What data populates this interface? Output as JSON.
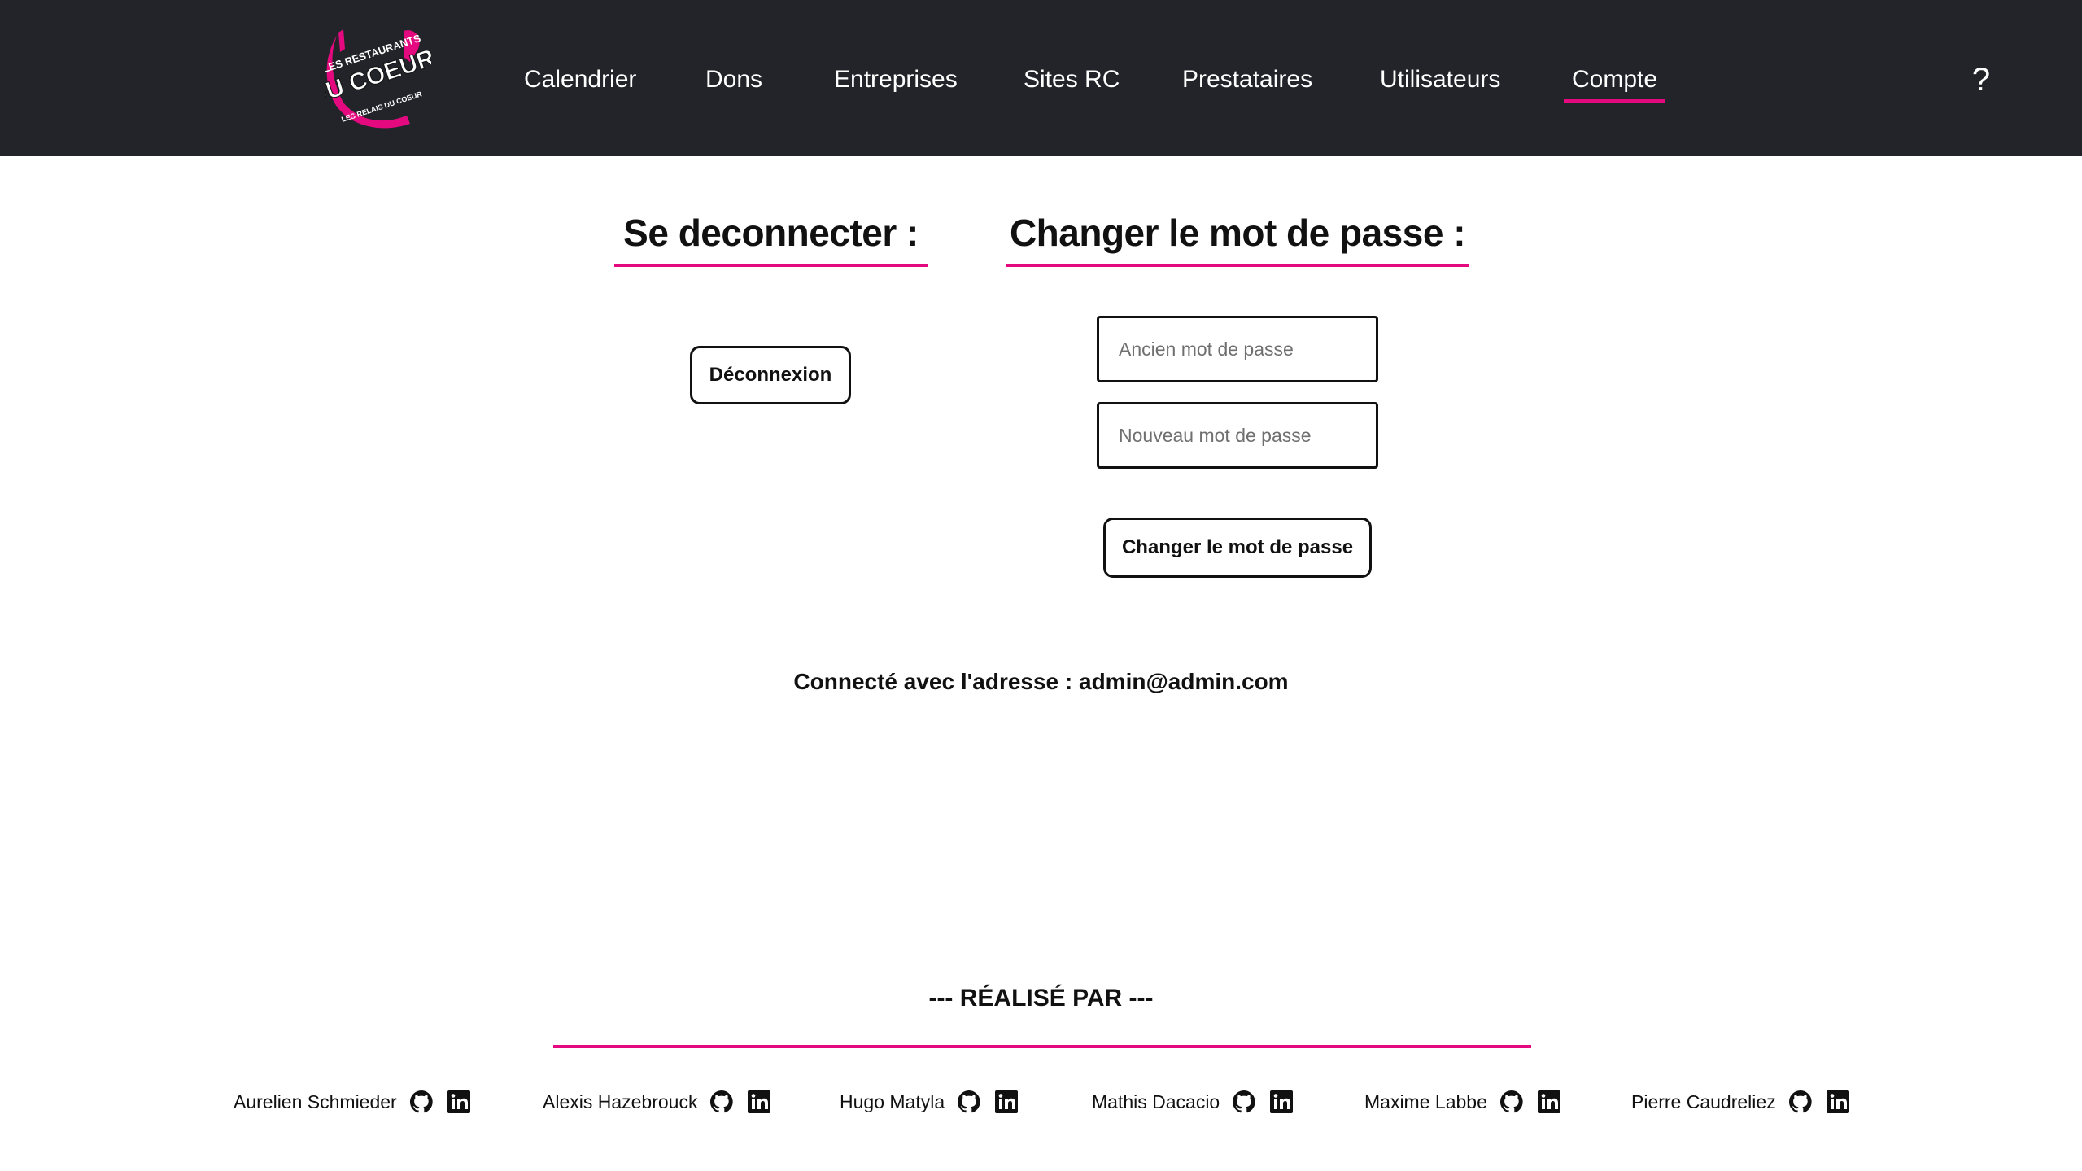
{
  "header": {
    "logo_text_top": "LES RESTAURANTS",
    "logo_text_main": "DU COEUR",
    "logo_text_sub": "LES RELAIS DU COEUR",
    "nav": [
      {
        "label": "Calendrier",
        "active": false
      },
      {
        "label": "Dons",
        "active": false
      },
      {
        "label": "Entreprises",
        "active": false
      },
      {
        "label": "Sites RC",
        "active": false
      },
      {
        "label": "Prestataires",
        "active": false
      },
      {
        "label": "Utilisateurs",
        "active": false
      },
      {
        "label": "Compte",
        "active": true
      }
    ],
    "help_label": "?"
  },
  "logout": {
    "title": "Se deconnecter :",
    "button_label": "Déconnexion"
  },
  "password": {
    "title": "Changer le mot de passe :",
    "old_placeholder": "Ancien mot de passe",
    "new_placeholder": "Nouveau mot de passe",
    "button_label": "Changer le mot de passe"
  },
  "connected_text": "Connecté avec l'adresse : admin@admin.com",
  "footer": {
    "title": "--- RÉALISÉ PAR ---",
    "authors": [
      "Aurelien Schmieder",
      "Alexis Hazebrouck",
      "Hugo Matyla",
      "Mathis Dacacio",
      "Maxime Labbe",
      "Pierre Caudreliez"
    ]
  },
  "colors": {
    "header_bg": "#23242a",
    "accent": "#e5097f",
    "text": "#111111"
  }
}
